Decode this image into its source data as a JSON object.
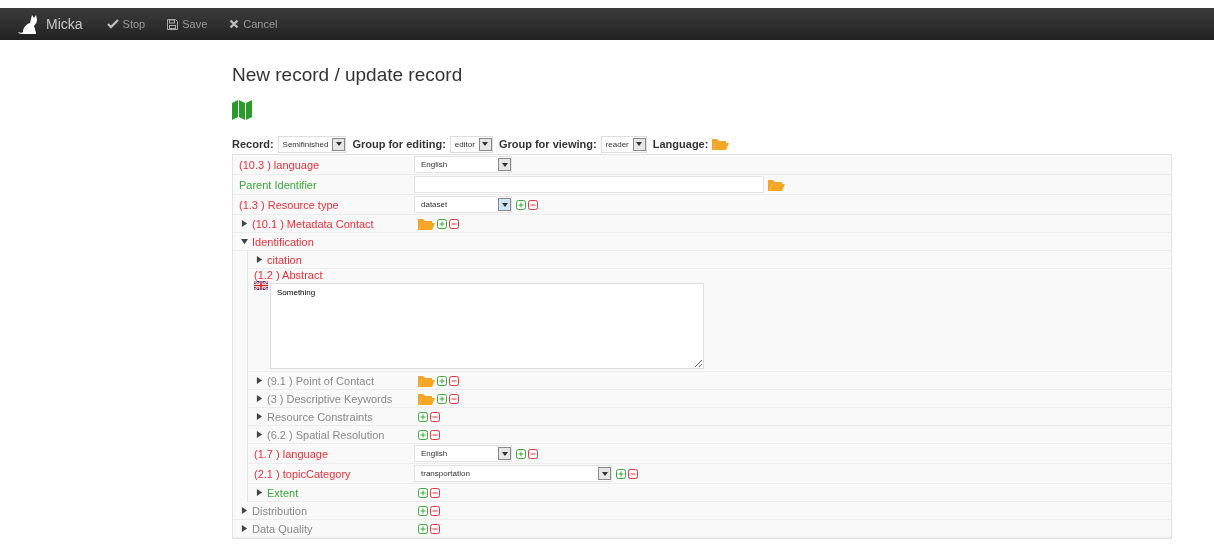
{
  "navbar": {
    "brand": "Micka",
    "buttons": [
      {
        "kind": "stop",
        "label": "Stop"
      },
      {
        "kind": "save",
        "label": "Save"
      },
      {
        "kind": "cancel",
        "label": "Cancel"
      }
    ]
  },
  "title": "New record / update record",
  "record_bar": {
    "fields": [
      {
        "label": "Record:",
        "value": "Semifinished"
      },
      {
        "label": "Group for editing:",
        "value": "editor"
      },
      {
        "label": "Group for viewing:",
        "value": "reader"
      }
    ],
    "language_label": "Language:"
  },
  "rows": [
    {
      "kind": "select",
      "label": "(10.3 ) language",
      "color": "#e8303a",
      "value": "English"
    },
    {
      "kind": "text",
      "label": "Parent Identifier",
      "color": "#3aa83a",
      "folder": true
    },
    {
      "kind": "select",
      "label": "(1.3 ) Resource type",
      "color": "#e8303a",
      "value": "dataset",
      "add_remove": true,
      "focused": true
    },
    {
      "kind": "group",
      "label": "(10.1 ) Metadata Contact",
      "color": "#e8303a",
      "expanded": false,
      "folder": true,
      "add_remove": true
    },
    {
      "kind": "group",
      "label": "Identification",
      "color": "#e8303a",
      "expanded": true,
      "children": [
        {
          "kind": "group",
          "label": "citation",
          "color": "#e8303a",
          "expanded": false
        },
        {
          "kind": "textarea",
          "label": "(1.2 ) Abstract",
          "color": "#e8303a",
          "value": "Something"
        },
        {
          "kind": "group",
          "label": "(9.1 ) Point of Contact",
          "color": "#8a8a8a",
          "expanded": false,
          "folder": true,
          "add_remove": true
        },
        {
          "kind": "group",
          "label": "(3 ) Descriptive Keywords",
          "color": "#8a8a8a",
          "expanded": false,
          "folder": true,
          "add_remove": true
        },
        {
          "kind": "group",
          "label": "Resource Constraints",
          "color": "#8a8a8a",
          "expanded": false,
          "add_remove": true
        },
        {
          "kind": "group",
          "label": "(6.2 ) Spatial Resolution",
          "color": "#8a8a8a",
          "expanded": false,
          "add_remove": true
        },
        {
          "kind": "select",
          "label": "(1.7 ) language",
          "color": "#e8303a",
          "value": "English",
          "add_remove": true
        },
        {
          "kind": "select",
          "label": "(2.1 ) topicCategory",
          "color": "#e8303a",
          "value": "transportation",
          "add_remove": true
        },
        {
          "kind": "group",
          "label": "Extent",
          "color": "#3aa83a",
          "expanded": false,
          "add_remove": true
        }
      ]
    },
    {
      "kind": "group",
      "label": "Distribution",
      "color": "#8a8a8a",
      "expanded": false,
      "add_remove": true
    },
    {
      "kind": "group",
      "label": "Data Quality",
      "color": "#8a8a8a",
      "expanded": false,
      "add_remove": true
    }
  ]
}
